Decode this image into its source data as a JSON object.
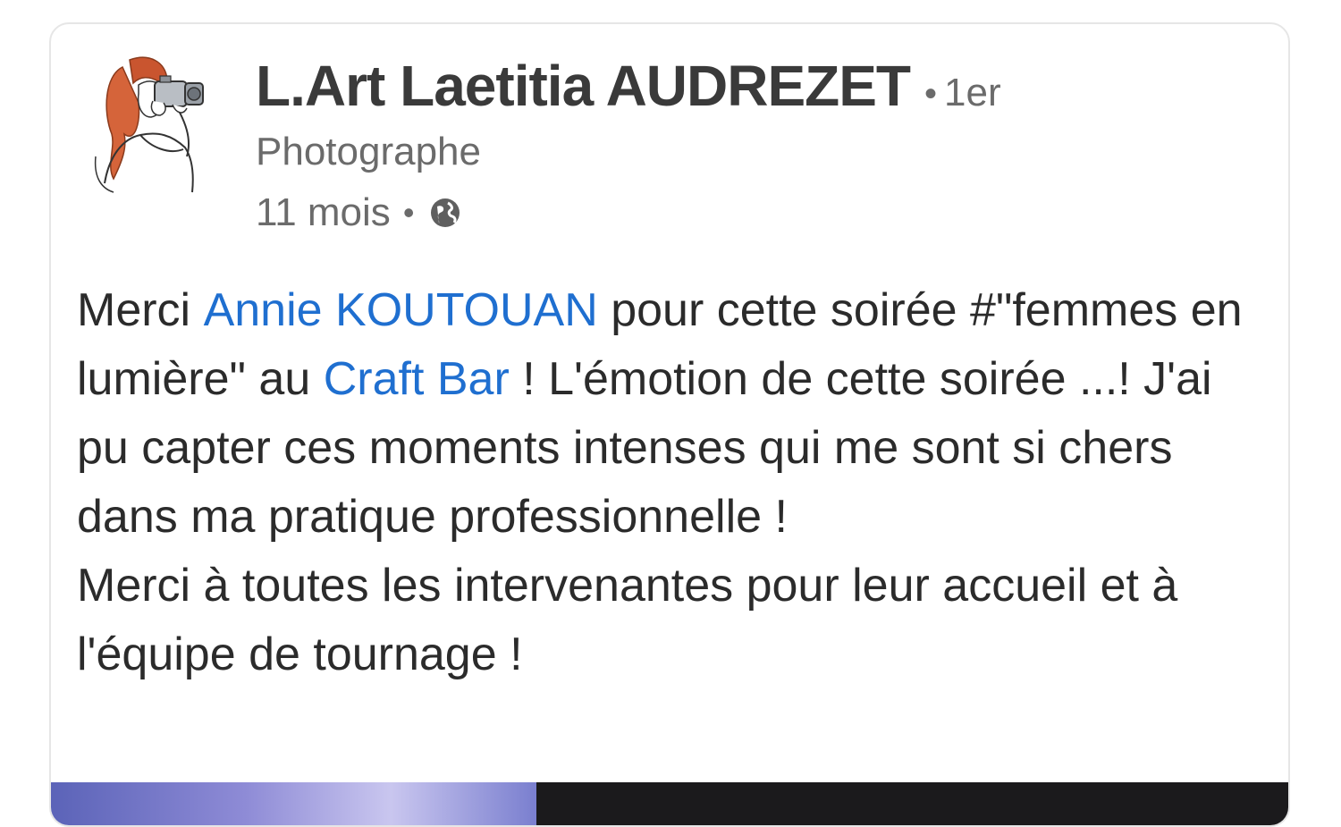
{
  "post": {
    "author": {
      "name": "L.Art Laetitia AUDREZET",
      "connection_degree": "1er",
      "headline": "Photographe"
    },
    "meta": {
      "age": "11 mois",
      "visibility_icon": "globe-icon"
    },
    "body": {
      "line1_pre": "Merci ",
      "mention1": "Annie KOUTOUAN",
      "line1_post": " pour cette soirée #\"femmes en lumière\" au ",
      "mention2": "Craft Bar",
      "line2_post": " ! L'émotion de cette soirée ...! J'ai pu capter ces moments intenses qui me sont si chers dans ma pratique professionnelle !",
      "paragraph2": "Merci à toutes les intervenantes pour leur accueil et à l'équipe de tournage !"
    }
  },
  "colors": {
    "mention": "#1f6fd0",
    "text": "#2b2b2b",
    "muted": "#6b6b6b",
    "name": "#3a3a3a"
  }
}
